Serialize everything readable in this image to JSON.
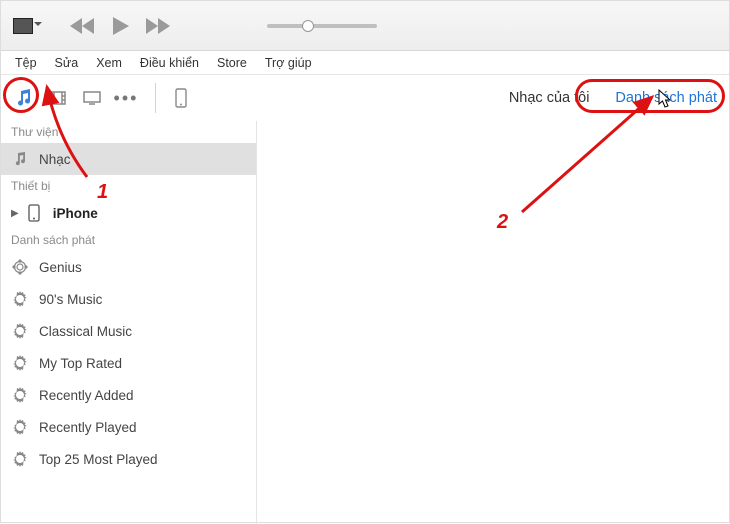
{
  "menu": {
    "items": [
      "Tệp",
      "Sửa",
      "Xem",
      "Điều khiển",
      "Store",
      "Trợ giúp"
    ]
  },
  "rightTabs": {
    "myMusic": "Nhạc của tôi",
    "playlists": "Danh sách phát"
  },
  "sidebar": {
    "libraryHeader": "Thư viện",
    "music": "Nhạc",
    "devicesHeader": "Thiết bị",
    "device": "iPhone",
    "playlistsHeader": "Danh sách phát",
    "playlists": [
      "Genius",
      "90's Music",
      "Classical Music",
      "My Top Rated",
      "Recently Added",
      "Recently Played",
      "Top 25 Most Played"
    ]
  },
  "annotations": {
    "step1": "1",
    "step2": "2"
  }
}
